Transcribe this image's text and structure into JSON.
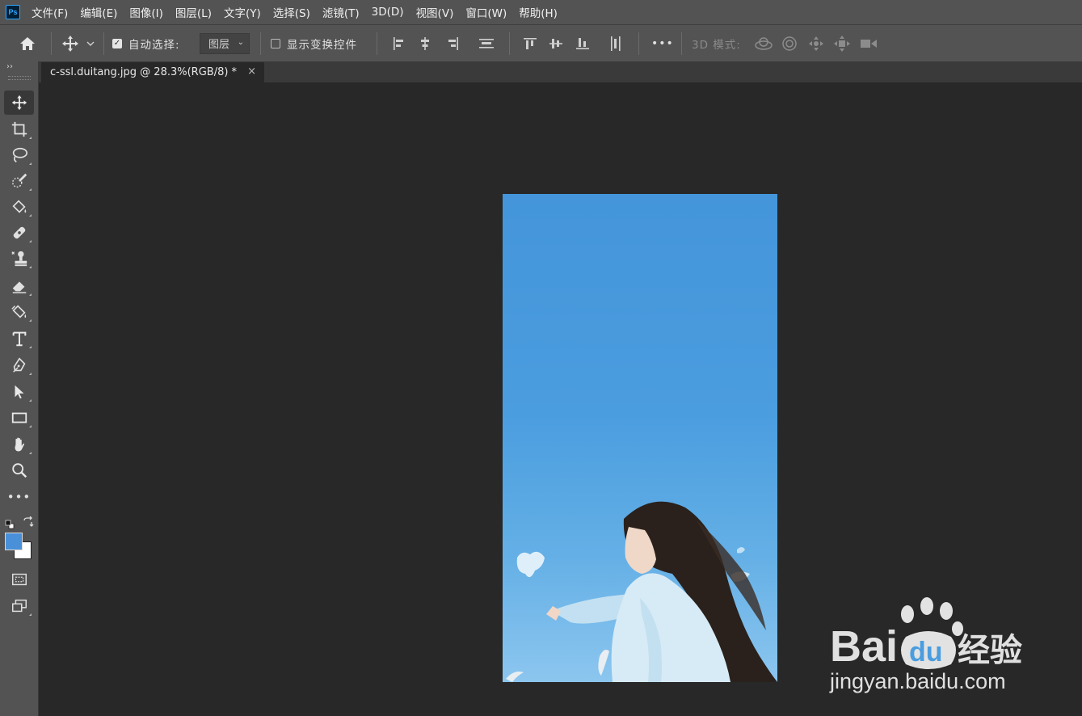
{
  "app": {
    "logo_text": "Ps"
  },
  "menu": [
    "文件(F)",
    "编辑(E)",
    "图像(I)",
    "图层(L)",
    "文字(Y)",
    "选择(S)",
    "滤镜(T)",
    "3D(D)",
    "视图(V)",
    "窗口(W)",
    "帮助(H)"
  ],
  "options_bar": {
    "auto_select_label": "自动选择:",
    "auto_select_checked": true,
    "auto_select_target": "图层",
    "show_transform_label": "显示变换控件",
    "show_transform_checked": false,
    "more_label": "•••",
    "mode_3d_label": "3D 模式:"
  },
  "document": {
    "tab_title": "c-ssl.duitang.jpg @ 28.3%(RGB/8) *",
    "close_glyph": "×"
  },
  "toolbar": {
    "collapse_glyph": "››",
    "more_glyph": "•••",
    "foreground_color": "#4a90d9",
    "background_color": "#ffffff"
  },
  "watermark": {
    "brand_left": "Bai",
    "brand_right": "经验",
    "url": "jingyan.baidu.com"
  }
}
